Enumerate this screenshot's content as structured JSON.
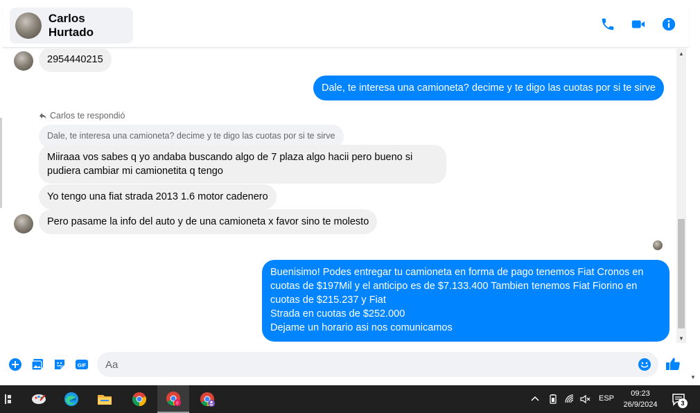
{
  "header": {
    "contact_name": "Carlos Hurtado",
    "icons": [
      "phone-icon",
      "video-camera-icon",
      "info-icon"
    ],
    "accent_color": "#0084ff"
  },
  "messages": {
    "m1_text": "2954440215",
    "m2_text": "Dale, te interesa una camioneta? decime y te digo las cuotas por si te sirve",
    "reply_label": "Carlos te respondió",
    "quoted_text": "Dale, te interesa una camioneta? decime y te digo las cuotas por si te sirve",
    "m3_line1": "Miiraaa vos sabes q yo andaba buscando algo de 7 plaza algo hacii pero bueno si",
    "m3_line2": "pudiera cambiar mi camionetita q tengo",
    "m4_text": "Yo tengo una fiat strada 2013 1.6 motor cadenero",
    "m5_text": "Pero pasame la info del auto y de una camioneta x  favor sino te molesto",
    "m6_line1": "Buenisimo! Podes entregar tu camioneta en forma de pago tenemos Fiat Cronos en",
    "m6_line2": "cuotas de $197Mil y el anticipo es de $7.133.400 Tambien tenemos Fiat Fiorino en",
    "m6_line3": "cuotas de $215.237 y Fiat",
    "m6_line4": "Strada en cuotas de $252.000",
    "m6_line5": "Dejame un horario asi nos comunicamos"
  },
  "composer": {
    "placeholder": "Aa",
    "icons": [
      "plus-circle-icon",
      "photo-icon",
      "sticker-icon",
      "gif-icon",
      "emoji-icon",
      "thumbs-up-icon"
    ],
    "gif_label": "GIF"
  },
  "taskbar": {
    "apps": [
      "task-view-icon",
      "paint-icon",
      "edge-icon",
      "file-explorer-icon",
      "chrome-icon",
      "chrome-profile-c-icon",
      "chrome-profile-2-icon"
    ],
    "profile_letter": "c",
    "language": "ESP",
    "time": "09:23",
    "date": "26/9/2024",
    "notification_count": "3"
  }
}
